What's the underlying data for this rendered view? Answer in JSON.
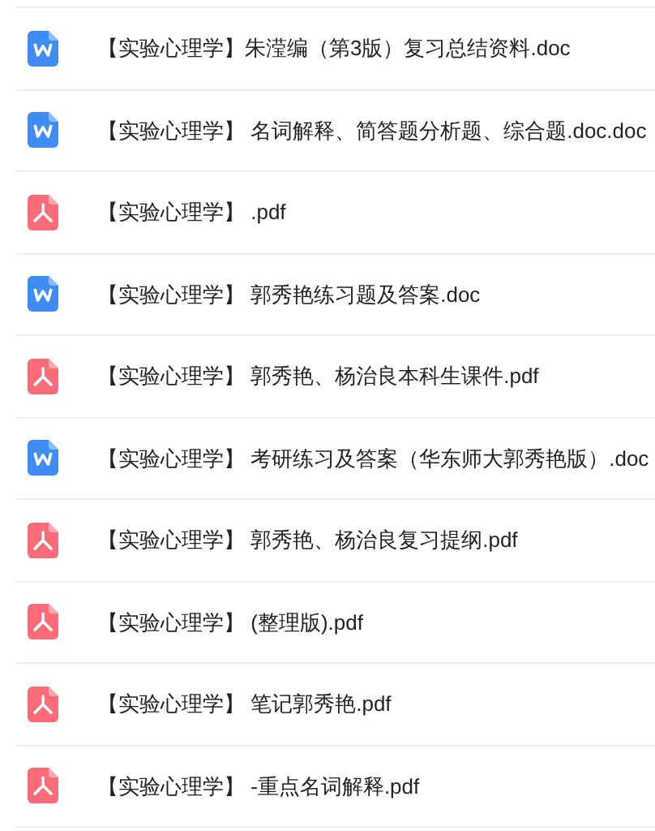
{
  "files": [
    {
      "kind": "doc",
      "name": "【实验心理学】朱滢编（第3版）复习总结资料.doc"
    },
    {
      "kind": "doc",
      "name": "【实验心理学】 名词解释、简答题分析题、综合题.doc.doc"
    },
    {
      "kind": "pdf",
      "name": "【实验心理学】 .pdf"
    },
    {
      "kind": "doc",
      "name": "【实验心理学】 郭秀艳练习题及答案.doc"
    },
    {
      "kind": "pdf",
      "name": "【实验心理学】 郭秀艳、杨治良本科生课件.pdf"
    },
    {
      "kind": "doc",
      "name": "【实验心理学】 考研练习及答案（华东师大郭秀艳版）.doc"
    },
    {
      "kind": "pdf",
      "name": "【实验心理学】 郭秀艳、杨治良复习提纲.pdf"
    },
    {
      "kind": "pdf",
      "name": "【实验心理学】 (整理版).pdf"
    },
    {
      "kind": "pdf",
      "name": "【实验心理学】 笔记郭秀艳.pdf"
    },
    {
      "kind": "pdf",
      "name": "【实验心理学】 -重点名词解释.pdf"
    }
  ]
}
